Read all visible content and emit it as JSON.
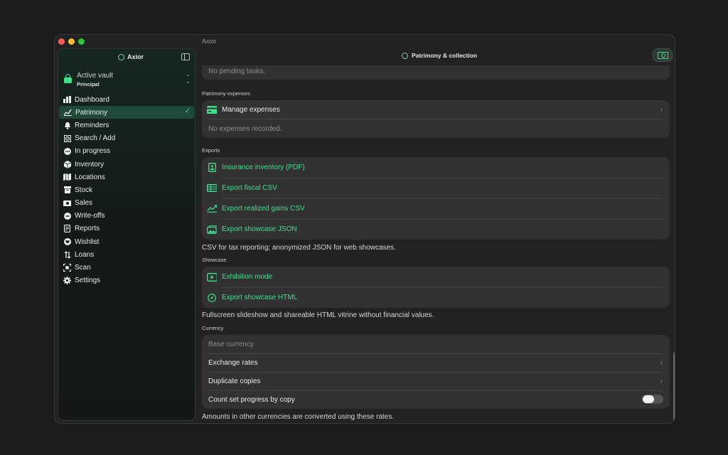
{
  "window": {
    "title": "Axior"
  },
  "sidebar": {
    "app_name": "Axior",
    "vault": {
      "title": "Active vault",
      "subtitle": "Principal"
    },
    "items": [
      {
        "label": "Dashboard",
        "icon": "chart-bar-icon"
      },
      {
        "label": "Patrimony",
        "icon": "trend-line-icon",
        "active": true
      },
      {
        "label": "Reminders",
        "icon": "bell-icon"
      },
      {
        "label": "Search / Add",
        "icon": "grid-icon"
      },
      {
        "label": "In progress",
        "icon": "ellipsis-circle-icon"
      },
      {
        "label": "Inventory",
        "icon": "cube-icon"
      },
      {
        "label": "Locations",
        "icon": "map-icon"
      },
      {
        "label": "Stock",
        "icon": "archive-box-icon"
      },
      {
        "label": "Sales",
        "icon": "banknote-icon"
      },
      {
        "label": "Write-offs",
        "icon": "minus-circle-icon"
      },
      {
        "label": "Reports",
        "icon": "document-icon"
      },
      {
        "label": "Wishlist",
        "icon": "heart-icon"
      },
      {
        "label": "Loans",
        "icon": "transfer-icon"
      },
      {
        "label": "Scan",
        "icon": "scan-icon"
      },
      {
        "label": "Settings",
        "icon": "gear-icon"
      }
    ]
  },
  "main": {
    "title": "Patrimony & collection",
    "tasks_card": {
      "empty": "No pending tasks."
    },
    "expenses": {
      "section": "Patrimony expenses",
      "manage": "Manage expenses",
      "empty": "No expenses recorded."
    },
    "exports": {
      "section": "Exports",
      "items": [
        {
          "label": "Insurance inventory (PDF)",
          "icon": "id-card-icon"
        },
        {
          "label": "Export fiscal CSV",
          "icon": "table-icon"
        },
        {
          "label": "Export realized gains CSV",
          "icon": "trend-line-icon"
        },
        {
          "label": "Export showcase JSON",
          "icon": "photos-icon"
        }
      ],
      "footnote": "CSV for tax reporting; anonymized JSON for web showcases."
    },
    "showcase": {
      "section": "Showcase",
      "items": [
        {
          "label": "Exhibition mode",
          "icon": "play-rectangle-icon"
        },
        {
          "label": "Export showcase HTML",
          "icon": "safari-compass-icon"
        }
      ],
      "footnote": "Fullscreen slideshow and shareable HTML vitrine without financial values."
    },
    "currency": {
      "section": "Currency",
      "base_placeholder": "Base currency",
      "exchange_rates": "Exchange rates",
      "duplicate_copies": "Duplicate copies",
      "count_progress": "Count set progress by copy",
      "count_progress_on": false,
      "footnote": "Amounts in other currencies are converted using these rates."
    }
  },
  "colors": {
    "accent": "#3fe08f",
    "active_row": "#1f4a38",
    "card": "#323232"
  }
}
